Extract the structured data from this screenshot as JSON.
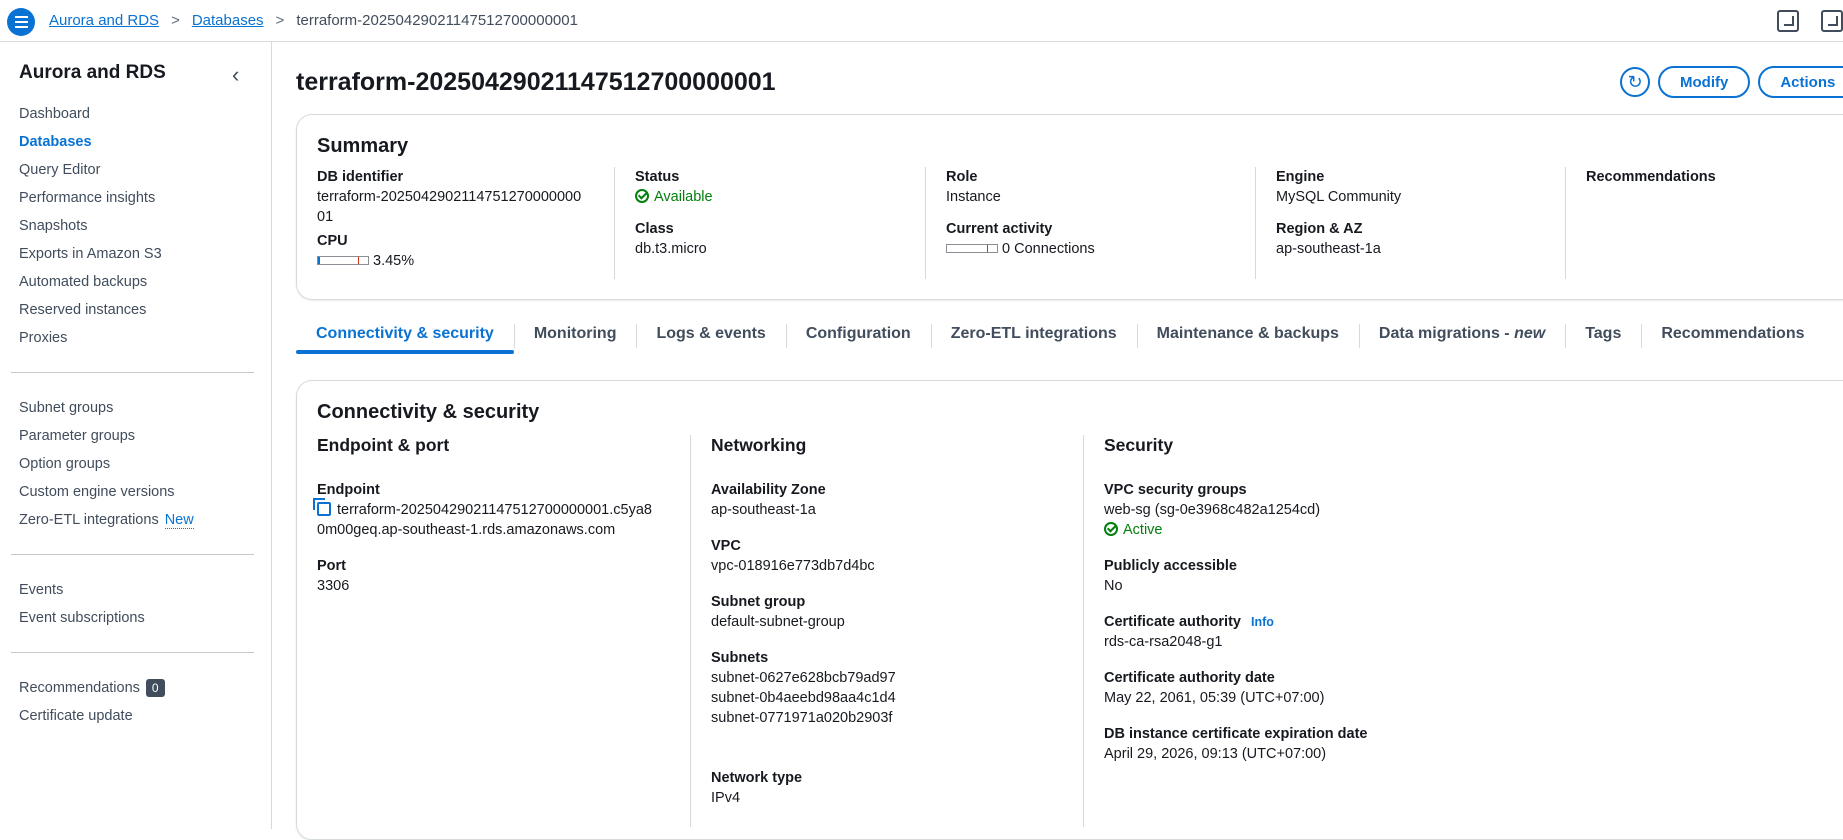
{
  "breadcrumb": {
    "root": "Aurora and RDS",
    "databases": "Databases",
    "current": "terraform-20250429021147512700000001"
  },
  "sidebar": {
    "title": "Aurora and RDS",
    "group1": [
      "Dashboard",
      "Databases",
      "Query Editor",
      "Performance insights",
      "Snapshots",
      "Exports in Amazon S3",
      "Automated backups",
      "Reserved instances",
      "Proxies"
    ],
    "group2": [
      "Subnet groups",
      "Parameter groups",
      "Option groups",
      "Custom engine versions",
      "Zero-ETL integrations"
    ],
    "zero_etl_new": "New",
    "group3": [
      "Events",
      "Event subscriptions"
    ],
    "recommendations": "Recommendations",
    "recommendations_count": "0",
    "certificate_update": "Certificate update"
  },
  "header": {
    "title": "terraform-20250429021147512700000001",
    "modify": "Modify",
    "actions": "Actions"
  },
  "summary": {
    "title": "Summary",
    "db_identifier_label": "DB identifier",
    "db_identifier_line1": "terraform-2025042902114751270000000",
    "db_identifier_line2": "01",
    "cpu_label": "CPU",
    "cpu_value": "3.45%",
    "cpu_fraction": 0.0345,
    "status_label": "Status",
    "status_value": "Available",
    "class_label": "Class",
    "class_value": "db.t3.micro",
    "role_label": "Role",
    "role_value": "Instance",
    "activity_label": "Current activity",
    "activity_value": "0 Connections",
    "activity_fraction": 0,
    "engine_label": "Engine",
    "engine_value": "MySQL Community",
    "region_label": "Region & AZ",
    "region_value": "ap-southeast-1a",
    "recommendations_label": "Recommendations"
  },
  "tabs": {
    "connectivity": "Connectivity & security",
    "monitoring": "Monitoring",
    "logs": "Logs & events",
    "configuration": "Configuration",
    "zero_etl": "Zero-ETL integrations",
    "maintenance": "Maintenance & backups",
    "data_migrations": "Data migrations - ",
    "data_migrations_new": "new",
    "tags": "Tags",
    "recommendations": "Recommendations"
  },
  "connectivity": {
    "title": "Connectivity & security",
    "endpoint_port": {
      "heading": "Endpoint & port",
      "endpoint_label": "Endpoint",
      "endpoint_line1": "terraform-20250429021147512700000001.c5ya8",
      "endpoint_line2": "0m00geq.ap-southeast-1.rds.amazonaws.com",
      "port_label": "Port",
      "port_value": "3306"
    },
    "networking": {
      "heading": "Networking",
      "az_label": "Availability Zone",
      "az_value": "ap-southeast-1a",
      "vpc_label": "VPC",
      "vpc_value": "vpc-018916e773db7d4bc",
      "subnet_group_label": "Subnet group",
      "subnet_group_value": "default-subnet-group",
      "subnets_label": "Subnets",
      "subnets": [
        "subnet-0627e628bcb79ad97",
        "subnet-0b4aeebd98aa4c1d4",
        "subnet-0771971a020b2903f"
      ],
      "network_type_label": "Network type",
      "network_type_value": "IPv4"
    },
    "security": {
      "heading": "Security",
      "vpc_sg_label": "VPC security groups",
      "vpc_sg_value": "web-sg (sg-0e3968c482a1254cd)",
      "vpc_sg_status": "Active",
      "public_label": "Publicly accessible",
      "public_value": "No",
      "ca_label": "Certificate authority",
      "ca_info": "Info",
      "ca_value": "rds-ca-rsa2048-g1",
      "ca_date_label": "Certificate authority date",
      "ca_date_value": "May 22, 2061, 05:39 (UTC+07:00)",
      "cert_exp_label": "DB instance certificate expiration date",
      "cert_exp_value": "April 29, 2026, 09:13 (UTC+07:00)"
    }
  }
}
